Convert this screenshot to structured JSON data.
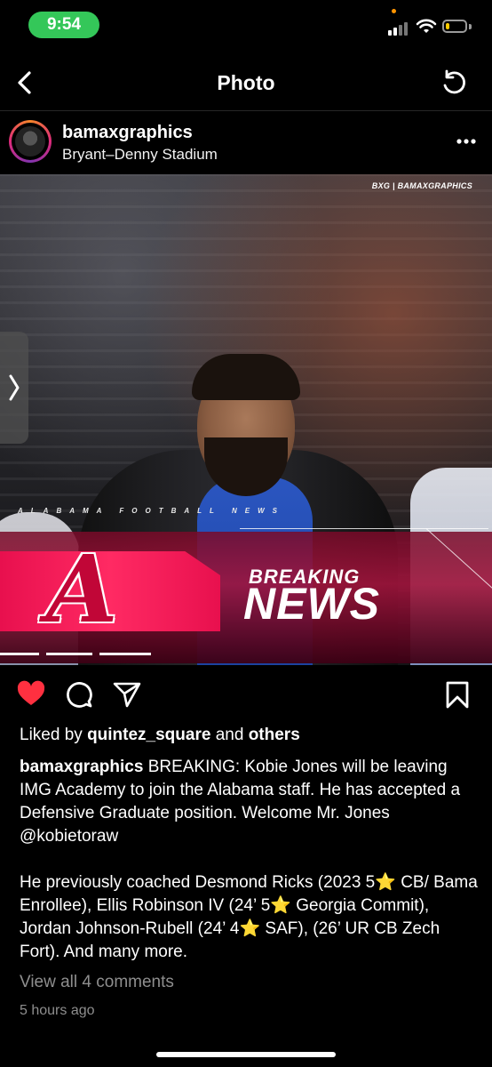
{
  "status_bar": {
    "time": "9:54",
    "icons": [
      "signal-icon",
      "wifi-icon",
      "battery-icon"
    ],
    "battery_level": 0.2,
    "battery_color": "#ffcc00",
    "time_pill_color": "#34c759"
  },
  "nav": {
    "title": "Photo",
    "back_icon": "chevron-left-icon",
    "refresh_icon": "refresh-icon"
  },
  "post": {
    "username": "bamaxgraphics",
    "location": "Bryant–Denny Stadium",
    "more_icon": "more-horizontal-icon",
    "image": {
      "brand_tag": "BXG | BAMAXGRAPHICS",
      "series_text": "ALABAMA FOOTBALL NEWS",
      "breaking_word": "BREAKING",
      "news_word": "NEWS",
      "logo_letter": "A",
      "accent_color": "#e8104e"
    },
    "actions": {
      "like_icon": "heart-icon",
      "comment_icon": "comment-icon",
      "share_icon": "send-icon",
      "save_icon": "bookmark-icon",
      "liked": true,
      "like_color": "#ff3040"
    },
    "likes": {
      "prefix": "Liked by",
      "user": "quintez_square",
      "middle": "and",
      "others": "others"
    },
    "caption": {
      "user": "bamaxgraphics",
      "para1": "BREAKING: Kobie Jones will be leaving IMG Academy to join the Alabama staff. He has accepted a Defensive Graduate position. Welcome Mr. Jones @kobietoraw",
      "para2": "He previously coached Desmond Ricks (2023 5⭐ CB/ Bama Enrollee), Ellis Robinson IV (24’ 5⭐ Georgia Commit), Jordan Johnson-Rubell (24’ 4⭐ SAF), (26’ UR CB Zech Fort). And many more."
    },
    "view_comments": "View all 4 comments",
    "timestamp": "5 hours ago"
  }
}
